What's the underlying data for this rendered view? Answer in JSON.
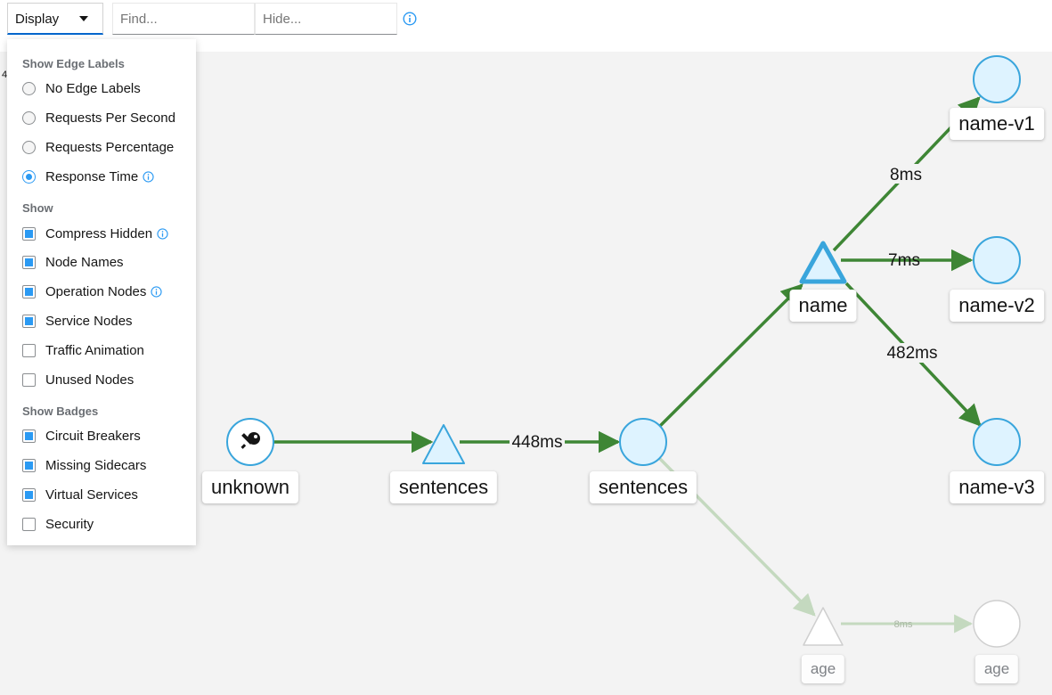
{
  "toolbar": {
    "display_label": "Display",
    "find_placeholder": "Find...",
    "hide_placeholder": "Hide..."
  },
  "side_fragment": "4",
  "display_menu": {
    "edge_labels_heading": "Show Edge Labels",
    "edge_label_options": [
      {
        "label": "No Edge Labels",
        "selected": false
      },
      {
        "label": "Requests Per Second",
        "selected": false
      },
      {
        "label": "Requests Percentage",
        "selected": false
      },
      {
        "label": "Response Time",
        "selected": true
      }
    ],
    "show_heading": "Show",
    "show_options": [
      {
        "label": "Compress Hidden",
        "checked": true
      },
      {
        "label": "Node Names",
        "checked": true
      },
      {
        "label": "Operation Nodes",
        "checked": true
      },
      {
        "label": "Service Nodes",
        "checked": true
      },
      {
        "label": "Traffic Animation",
        "checked": false
      },
      {
        "label": "Unused Nodes",
        "checked": false
      }
    ],
    "badges_heading": "Show Badges",
    "badge_options": [
      {
        "label": "Circuit Breakers",
        "checked": true
      },
      {
        "label": "Missing Sidecars",
        "checked": true
      },
      {
        "label": "Virtual Services",
        "checked": true
      },
      {
        "label": "Security",
        "checked": false
      }
    ]
  },
  "graph": {
    "nodes": {
      "unknown": "unknown",
      "sentences_service": "sentences",
      "sentences_app": "sentences",
      "name_service": "name",
      "name_v1": "name-v1",
      "name_v2": "name-v2",
      "name_v3": "name-v3",
      "age_service": "age",
      "age_app": "age"
    },
    "edges": {
      "sentences_to_sentences": "448ms",
      "name_to_v1": "8ms",
      "name_to_v2": "7ms",
      "name_to_v3": "482ms",
      "age_edge": "8ms"
    }
  },
  "colors": {
    "edge_healthy": "#3e8635",
    "edge_faded": "#c4d9bf",
    "node_fill": "#def3ff",
    "node_stroke": "#39a5dc",
    "accent": "#2b9af3"
  }
}
